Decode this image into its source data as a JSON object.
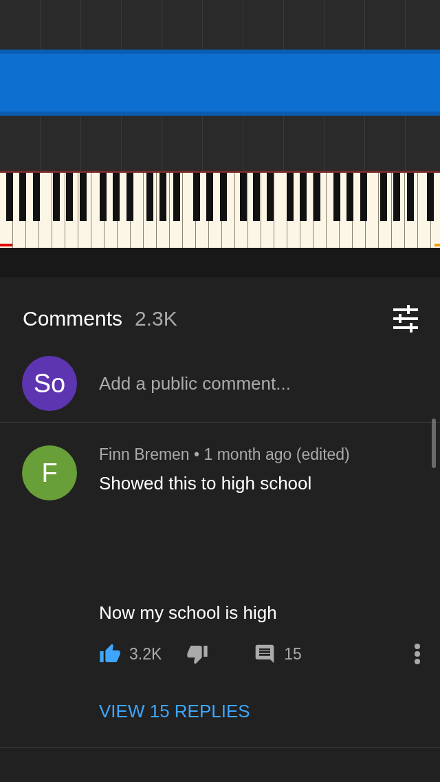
{
  "comments": {
    "title": "Comments",
    "count": "2.3K",
    "composer": {
      "avatar_initials": "So",
      "placeholder": "Add a public comment..."
    },
    "items": [
      {
        "avatar_initial": "F",
        "author": "Finn Bremen",
        "separator": "•",
        "time": "1 month ago (edited)",
        "text": "Showed this to high school\n\n\n\n\nNow my school is high",
        "likes": "3.2K",
        "liked": true,
        "disliked": false,
        "reply_count": "15",
        "view_replies": "VIEW 15 REPLIES"
      }
    ]
  }
}
